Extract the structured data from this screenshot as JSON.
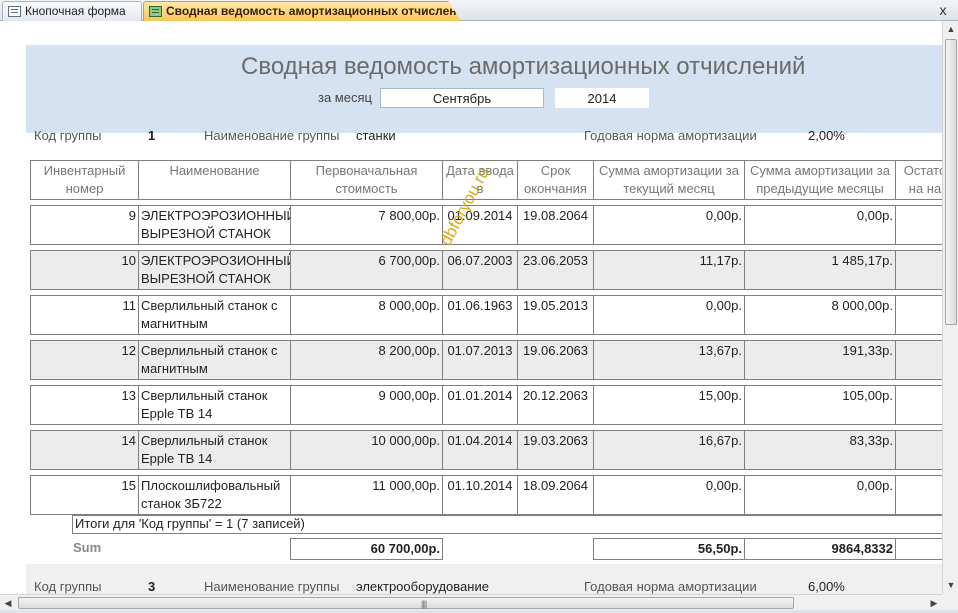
{
  "tabs": [
    {
      "label": "Кнопочная форма",
      "icon": "form-icon",
      "active": false
    },
    {
      "label": "Сводная ведомость амортизационных отчислений",
      "icon": "report-icon",
      "active": true
    }
  ],
  "close_glyph": "x",
  "report": {
    "title": "Сводная ведомость амортизационных отчислений",
    "month_label": "за месяц",
    "month": "Сентябрь",
    "year": "2014"
  },
  "group1": {
    "code_label": "Код группы",
    "code": "1",
    "name_label": "Наименование группы",
    "name": "станки",
    "rate_label": "Годовая норма амортизации",
    "rate": "2,00%"
  },
  "columns": [
    "Инвентарный номер",
    "Наименование",
    "Первоначальная стоимость",
    "Дата ввода в",
    "Срок окончания",
    "Сумма амортизации за текущий месяц",
    "Сумма амортизации за предыдущие месяцы",
    "Остато на на"
  ],
  "rows": [
    {
      "inv": "9",
      "name": "ЭЛЕКТРОЭРОЗИОННЫЙ ВЫРЕЗНОЙ СТАНОК",
      "cost": "7 800,00р.",
      "start": "01.09.2014",
      "end": "19.08.2064",
      "cur": "0,00р.",
      "prev": "0,00р."
    },
    {
      "inv": "10",
      "name": "ЭЛЕКТРОЭРОЗИОННЫЙ ВЫРЕЗНОЙ СТАНОК",
      "cost": "6 700,00р.",
      "start": "06.07.2003",
      "end": "23.06.2053",
      "cur": "11,17р.",
      "prev": "1 485,17р."
    },
    {
      "inv": "11",
      "name": "Сверлильный станок с магнитным",
      "cost": "8 000,00р.",
      "start": "01.06.1963",
      "end": "19.05.2013",
      "cur": "0,00р.",
      "prev": "8 000,00р."
    },
    {
      "inv": "12",
      "name": "Сверлильный станок с магнитным",
      "cost": "8 200,00р.",
      "start": "01.07.2013",
      "end": "19.06.2063",
      "cur": "13,67р.",
      "prev": "191,33р."
    },
    {
      "inv": "13",
      "name": "Сверлильный станок Epple TB 14",
      "cost": "9 000,00р.",
      "start": "01.01.2014",
      "end": "20.12.2063",
      "cur": "15,00р.",
      "prev": "105,00р."
    },
    {
      "inv": "14",
      "name": "Сверлильный станок Epple TB 14",
      "cost": "10 000,00р.",
      "start": "01.04.2014",
      "end": "19.03.2063",
      "cur": "16,67р.",
      "prev": "83,33р."
    },
    {
      "inv": "15",
      "name": "Плоскошлифовальный станок 3Б722",
      "cost": "11 000,00р.",
      "start": "01.10.2014",
      "end": "18.09.2064",
      "cur": "0,00р.",
      "prev": "0,00р."
    }
  ],
  "totals": {
    "group_summary": "Итоги для 'Код группы' = 1 (7 записей)",
    "sum_label": "Sum",
    "cost": "60 700,00р.",
    "cur": "56,50р.",
    "prev": "9864,8332"
  },
  "group2": {
    "code_label": "Код группы",
    "code": "3",
    "name_label": "Наименование группы",
    "name": "электрооборудование",
    "rate_label": "Годовая норма амортизации",
    "rate": "6,00%"
  },
  "watermark": "dbforyou.ru",
  "scroll": {
    "up": "▲",
    "down": "▼",
    "left": "◀",
    "right": "▶",
    "grip": "||||"
  }
}
